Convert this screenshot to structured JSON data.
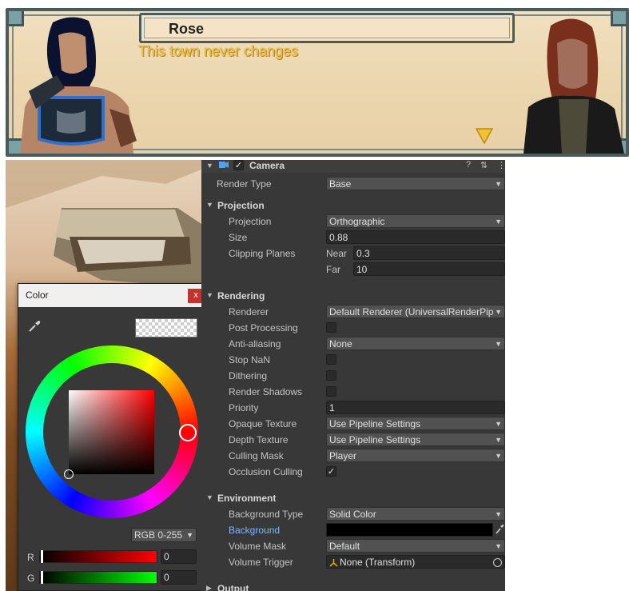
{
  "dialogue": {
    "speaker": "Rose",
    "line": "This town never changes",
    "continue_icon": "down-triangle-icon"
  },
  "color_picker": {
    "title": "Color",
    "close_label": "x",
    "mode": "RGB 0-255",
    "channels": [
      {
        "label": "R",
        "value": "0",
        "color": "#ff0000"
      },
      {
        "label": "G",
        "value": "0",
        "color": "#00ff00"
      }
    ]
  },
  "inspector": {
    "component": {
      "name": "Camera",
      "help_icon": "?",
      "settings_icon": "⇅",
      "menu_icon": "⋮"
    },
    "render_type": {
      "label": "Render Type",
      "value": "Base"
    },
    "projection_section": {
      "title": "Projection",
      "projection": {
        "label": "Projection",
        "value": "Orthographic"
      },
      "size": {
        "label": "Size",
        "value": "0.88"
      },
      "clipping": {
        "label": "Clipping Planes",
        "near_label": "Near",
        "near": "0.3",
        "far_label": "Far",
        "far": "10"
      }
    },
    "rendering_section": {
      "title": "Rendering",
      "renderer": {
        "label": "Renderer",
        "value": "Default Renderer (UniversalRenderPip"
      },
      "post_processing": {
        "label": "Post Processing",
        "checked": false
      },
      "anti_aliasing": {
        "label": "Anti-aliasing",
        "value": "None"
      },
      "stop_nan": {
        "label": "Stop NaN",
        "checked": false
      },
      "dithering": {
        "label": "Dithering",
        "checked": false
      },
      "render_shadows": {
        "label": "Render Shadows",
        "checked": false
      },
      "priority": {
        "label": "Priority",
        "value": "1"
      },
      "opaque_texture": {
        "label": "Opaque Texture",
        "value": "Use Pipeline Settings"
      },
      "depth_texture": {
        "label": "Depth Texture",
        "value": "Use Pipeline Settings"
      },
      "culling_mask": {
        "label": "Culling Mask",
        "value": "Player"
      },
      "occlusion_culling": {
        "label": "Occlusion Culling",
        "checked": true,
        "mark": "✓"
      }
    },
    "environment_section": {
      "title": "Environment",
      "background_type": {
        "label": "Background Type",
        "value": "Solid Color"
      },
      "background": {
        "label": "Background",
        "color": "#000000"
      },
      "volume_mask": {
        "label": "Volume Mask",
        "value": "Default"
      },
      "volume_trigger": {
        "label": "Volume Trigger",
        "value": "None (Transform)"
      }
    },
    "output_section": {
      "title": "Output"
    }
  },
  "colors": {
    "inspector_bg": "#383838",
    "link_blue": "#7cb7ff",
    "dialogue_text_gold": "#efc24a"
  }
}
